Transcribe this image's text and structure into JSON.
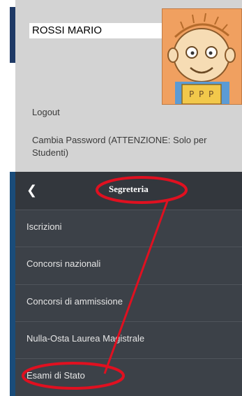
{
  "user": {
    "name": "ROSSI MARIO"
  },
  "links": {
    "logout": "Logout",
    "change_password": "Cambia Password (ATTENZIONE: Solo per Studenti)"
  },
  "menu": {
    "back_icon": "chevron-left-icon",
    "title": "Segreteria",
    "items": [
      {
        "label": "Iscrizioni"
      },
      {
        "label": "Concorsi nazionali"
      },
      {
        "label": "Concorsi di ammissione"
      },
      {
        "label": "Nulla-Osta Laurea Magistrale"
      },
      {
        "label": "Esami di Stato"
      }
    ]
  },
  "annotation": {
    "color": "#e01020"
  },
  "colors": {
    "panel_bg": "#d3d3d3",
    "menu_bg": "#3c4148",
    "accent": "#1a4c7a"
  }
}
